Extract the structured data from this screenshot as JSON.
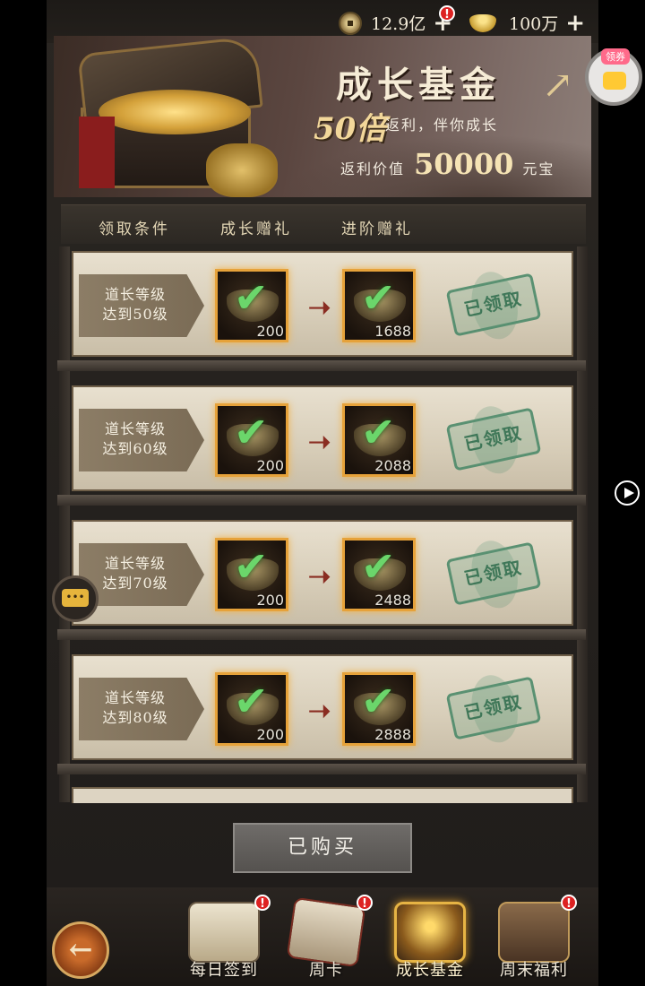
{
  "currency": {
    "coins": "12.9亿",
    "ingots": "100万",
    "notify": "!"
  },
  "banner": {
    "title": "成长基金",
    "multiplier": "50倍",
    "subtitle": "返利，伴你成长",
    "value_prefix": "返利价值",
    "value_amount": "50000",
    "value_unit": "元宝"
  },
  "coupon": {
    "tag": "领券"
  },
  "table_header": {
    "col1": "领取条件",
    "col2": "成长赠礼",
    "col3": "进阶赠礼"
  },
  "rows": [
    {
      "cond_line1": "道长等级",
      "cond_line2": "达到50级",
      "reward1": "200",
      "reward2": "1688",
      "status": "已领取"
    },
    {
      "cond_line1": "道长等级",
      "cond_line2": "达到60级",
      "reward1": "200",
      "reward2": "2088",
      "status": "已领取"
    },
    {
      "cond_line1": "道长等级",
      "cond_line2": "达到70级",
      "reward1": "200",
      "reward2": "2488",
      "status": "已领取"
    },
    {
      "cond_line1": "道长等级",
      "cond_line2": "达到80级",
      "reward1": "200",
      "reward2": "2888",
      "status": "已领取"
    }
  ],
  "buy_button": "已购买",
  "bottom_nav": [
    {
      "label": "每日签到",
      "badge": "!"
    },
    {
      "label": "周卡",
      "badge": "!"
    },
    {
      "label": "成长基金",
      "badge": ""
    },
    {
      "label": "周末福利",
      "badge": "!"
    }
  ],
  "icons": {
    "back": "back-arrow-icon",
    "chat": "chat-icon",
    "play": "play-icon"
  }
}
